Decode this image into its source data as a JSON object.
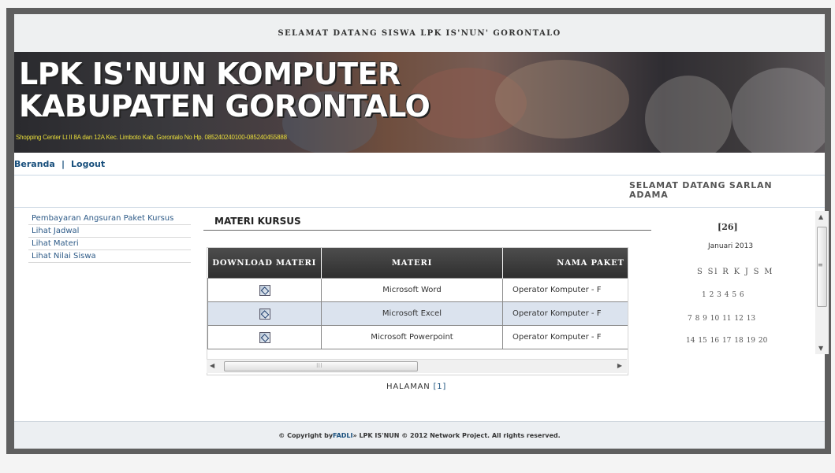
{
  "header": {
    "welcome_text": "SELAMAT DATANG SISWA LPK IS'NUN' GORONTALO"
  },
  "banner": {
    "title_line1": "LPK IS'NUN KOMPUTER",
    "title_line2": "KABUPATEN GORONTALO",
    "address": "Shopping Center Lt II 8A dan 12A Kec. Limboto Kab. Gorontalo No Hp. 085240240100-085240455888"
  },
  "nav": {
    "home_label": "Beranda",
    "separator": "|",
    "logout_label": "Logout"
  },
  "user": {
    "greeting": "SELAMAT DATANG SARLAN ADAMA"
  },
  "sidebar": {
    "items": [
      {
        "label": "Pembayaran Angsuran Paket Kursus"
      },
      {
        "label": "Lihat Jadwal"
      },
      {
        "label": "Lihat Materi"
      },
      {
        "label": "Lihat Nilai Siswa"
      }
    ]
  },
  "content": {
    "title": "MATERI KURSUS",
    "columns": [
      "DOWNLOAD MATERI",
      "MATERI",
      "NAMA PAKET KU"
    ],
    "rows": [
      {
        "materi": "Microsoft Word",
        "nama_paket": "Operator Komputer - F"
      },
      {
        "materi": "Microsoft Excel",
        "nama_paket": "Operator Komputer - F"
      },
      {
        "materi": "Microsoft Powerpoint",
        "nama_paket": "Operator Komputer - F"
      }
    ],
    "pagination_label": "HALAMAN",
    "pagination_page": "[1]"
  },
  "calendar": {
    "title": "[26]",
    "month": "Januari 2013",
    "days": "S Sl R K J S M",
    "weeks": [
      "1  2  3  4  5  6",
      "7  8  9 10 11 12 13",
      "14 15 16 17 18 19 20"
    ]
  },
  "footer": {
    "prefix": "© Copyright by ",
    "author": "FADLI",
    "suffix": " » LPK IS'NUN © 2012 Network Project. All rights reserved."
  },
  "colors": {
    "link": "#184f7c",
    "banner_text": "#ffffff",
    "address_text": "#e8dd3a",
    "table_header": "#3a3a3a",
    "table_row_alt": "#dbe3ee"
  }
}
